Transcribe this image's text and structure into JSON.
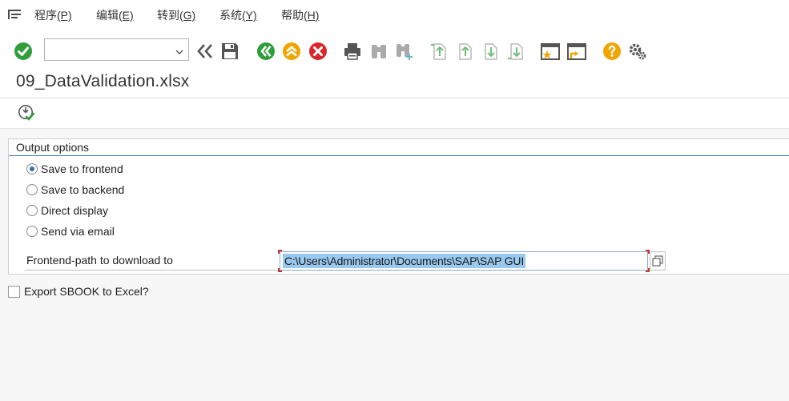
{
  "menu": {
    "items": [
      {
        "label": "程序",
        "accel": "(P)"
      },
      {
        "label": "编辑",
        "accel": "(E)"
      },
      {
        "label": "转到",
        "accel": "(G)"
      },
      {
        "label": "系统",
        "accel": "(Y)"
      },
      {
        "label": "帮助",
        "accel": "(H)"
      }
    ]
  },
  "toolbar": {
    "command_field": {
      "value": "",
      "placeholder": ""
    },
    "icons": [
      "enter-check-icon",
      "command-dropdown-icon",
      "double-chevron-left-icon",
      "save-icon",
      "back-icon",
      "exit-icon",
      "cancel-icon",
      "print-icon",
      "find-icon",
      "find-next-icon",
      "first-page-icon",
      "previous-page-icon",
      "next-page-icon",
      "last-page-icon",
      "create-session-icon",
      "generate-shortcut-icon",
      "help-icon",
      "customize-layout-icon"
    ]
  },
  "page": {
    "title": "09_DataValidation.xlsx"
  },
  "output_options": {
    "group_title": "Output options",
    "radios": [
      {
        "label": "Save to frontend",
        "selected": true
      },
      {
        "label": "Save to backend",
        "selected": false
      },
      {
        "label": "Direct display",
        "selected": false
      },
      {
        "label": "Send via email",
        "selected": false
      }
    ],
    "path_label": "Frontend-path to download to",
    "path_value": "C:\\Users\\Administrator\\Documents\\SAP\\SAP GUI"
  },
  "export_checkbox": {
    "label": "Export SBOOK to Excel?",
    "checked": false
  },
  "colors": {
    "green": "#2e9d3a",
    "orange": "#f0a500",
    "red": "#d9262c",
    "gray": "#555555",
    "accent_blue": "#4a7bb0"
  }
}
